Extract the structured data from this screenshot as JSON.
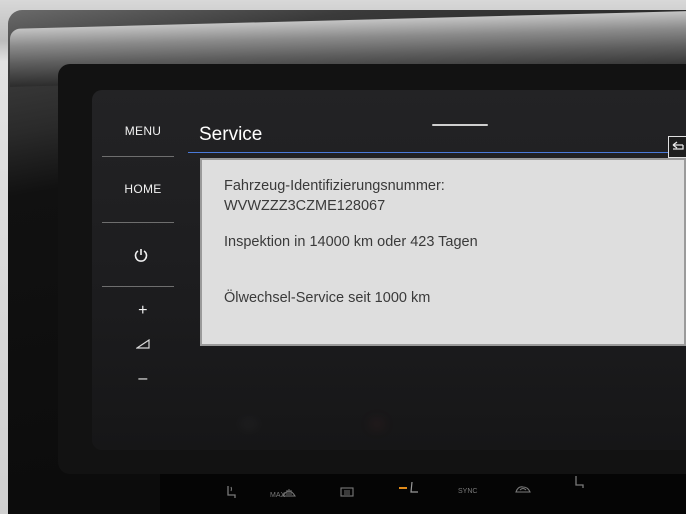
{
  "sidebar": {
    "menu_label": "MENU",
    "home_label": "HOME",
    "power_icon": "power-icon",
    "volume_up_label": "+",
    "volume_icon": "volume-icon",
    "volume_down_label": "–"
  },
  "header": {
    "title": "Service",
    "back_icon": "back-arrow-icon"
  },
  "dialog": {
    "vin_label": "Fahrzeug-Identifizierungsnummer:",
    "vin_value": "WVWZZZ3CZME128067",
    "inspection_text": "Inspektion in 14000 km oder 423 Tagen",
    "oil_service_text": "Ölwechsel-Service seit 1000 km"
  },
  "climate_bar": {
    "seat_heat_icon": "seat-heat-icon",
    "max_defrost_label": "MAX",
    "rear_defrost_icon": "rear-defrost-icon",
    "seat_recline_icon": "seat-recline-icon",
    "sync_label": "SYNC",
    "recirculation_icon": "recirculation-icon",
    "seat_right_icon": "seat-right-icon"
  },
  "colors": {
    "accent": "#4a7ad9",
    "dialog_bg": "#dedede",
    "screen_bg": "#1c1c1e"
  }
}
